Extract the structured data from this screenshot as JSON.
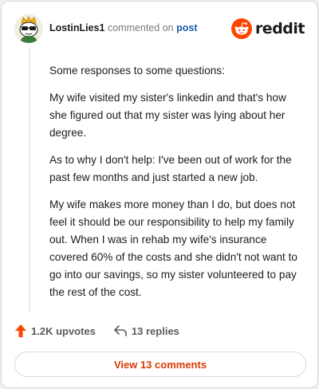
{
  "comment": {
    "username": "LostinLies1",
    "action_text": "commented on",
    "post_link": "post",
    "paragraphs": [
      "Some responses to some questions:",
      "My wife visited my sister's linkedin and that's how she figured out that my sister was lying about her degree.",
      "As to why I don't help: I've been out of work for the past few months and just started a new job.",
      "My wife makes more money than I do, but does not feel it should be our responsibility to help my family out. When I was in rehab my wife's insurance covered 60% of the costs and she didn't not want to go into our savings, so my sister volunteered to pay the rest of the cost."
    ],
    "upvotes": "1.2K upvotes",
    "replies": "13 replies",
    "view_comments": "View 13 comments"
  },
  "brand": {
    "name": "reddit",
    "color": "#ff4500"
  },
  "icons": {
    "avatar": "snoo-avatar",
    "upvote": "upvote-arrow-icon",
    "reply": "reply-arrow-icon",
    "logo": "reddit-logo-icon"
  },
  "colors": {
    "upvote": "#ff4500",
    "link": "#1c5fa8",
    "button_text": "#d93a00"
  }
}
